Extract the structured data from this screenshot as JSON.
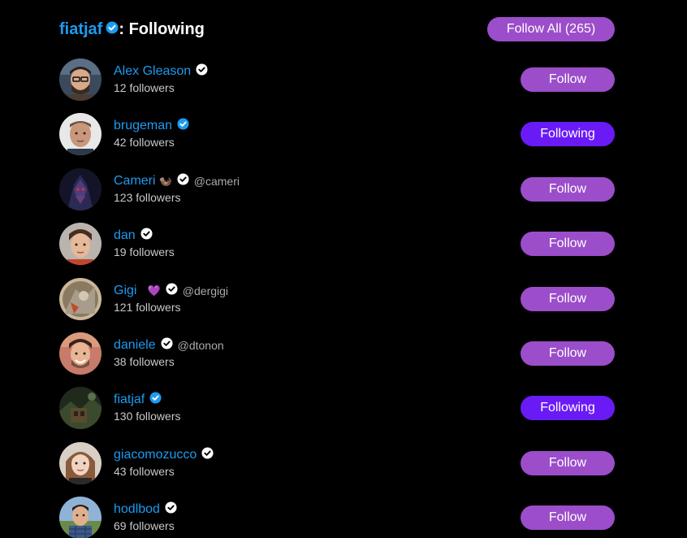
{
  "header": {
    "user": "fiatjaf",
    "separator": ": ",
    "title": "Following",
    "follow_all_label": "Follow All (265)"
  },
  "colors": {
    "background": "#000000",
    "link_blue": "#1d9bf0",
    "follow_button": "#9b4dca",
    "following_button": "#6a1bf5"
  },
  "users": [
    {
      "name": "Alex Gleason",
      "emoji": "",
      "handle": "",
      "followers": "12 followers",
      "button": "Follow",
      "following": false,
      "badge": "white"
    },
    {
      "name": "brugeman",
      "emoji": "",
      "handle": "",
      "followers": "42 followers",
      "button": "Following",
      "following": true,
      "badge": "blue"
    },
    {
      "name": "Cameri",
      "emoji": "🦦",
      "handle": "@cameri",
      "followers": "123 followers",
      "button": "Follow",
      "following": false,
      "badge": "white"
    },
    {
      "name": "dan",
      "emoji": "",
      "handle": "",
      "followers": "19 followers",
      "button": "Follow",
      "following": false,
      "badge": "white"
    },
    {
      "name": "Gigi",
      "emoji": "⚡💜",
      "handle": "@dergigi",
      "followers": "121 followers",
      "button": "Follow",
      "following": false,
      "badge": "white"
    },
    {
      "name": "daniele",
      "emoji": "",
      "handle": "@dtonon",
      "followers": "38 followers",
      "button": "Follow",
      "following": false,
      "badge": "white"
    },
    {
      "name": "fiatjaf",
      "emoji": "",
      "handle": "",
      "followers": "130 followers",
      "button": "Following",
      "following": true,
      "badge": "blue"
    },
    {
      "name": "giacomozucco",
      "emoji": "",
      "handle": "",
      "followers": "43 followers",
      "button": "Follow",
      "following": false,
      "badge": "white"
    },
    {
      "name": "hodlbod",
      "emoji": "",
      "handle": "",
      "followers": "69 followers",
      "button": "Follow",
      "following": false,
      "badge": "white"
    }
  ]
}
